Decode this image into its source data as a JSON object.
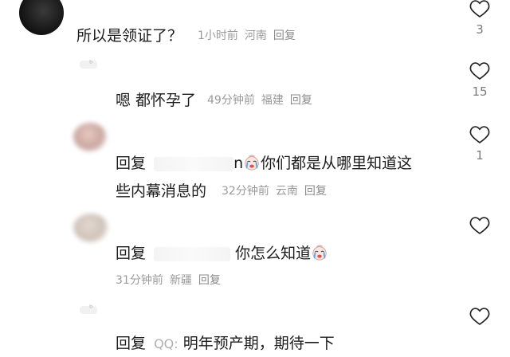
{
  "comments": [
    {
      "text": "所以是领证了？",
      "time": "1小时前",
      "location": "河南",
      "reply": "回复",
      "likes": "3"
    },
    {
      "text": "嗯 都怀孕了",
      "time": "49分钟前",
      "location": "福建",
      "reply": "回复",
      "likes": "15"
    },
    {
      "prefix": "回复",
      "name_tail": "n",
      "text_line1": "你们都是从哪里知道这",
      "text_line2": "些内幕消息的",
      "time": "32分钟前",
      "location": "云南",
      "reply": "回复",
      "likes": "1"
    },
    {
      "prefix": "回复",
      "text": "你怎么知道",
      "time": "31分钟前",
      "location": "新疆",
      "reply": "回复"
    },
    {
      "prefix": "回复",
      "source": "QQ:",
      "text": "明年预产期，期待一下"
    }
  ],
  "icons": {
    "like": "heart-outline-icon",
    "emoji": "crying-face-emoji-icon"
  },
  "colors": {
    "text": "#1c1c1c",
    "meta": "#9a9a9a",
    "like_stroke": "#222222"
  }
}
